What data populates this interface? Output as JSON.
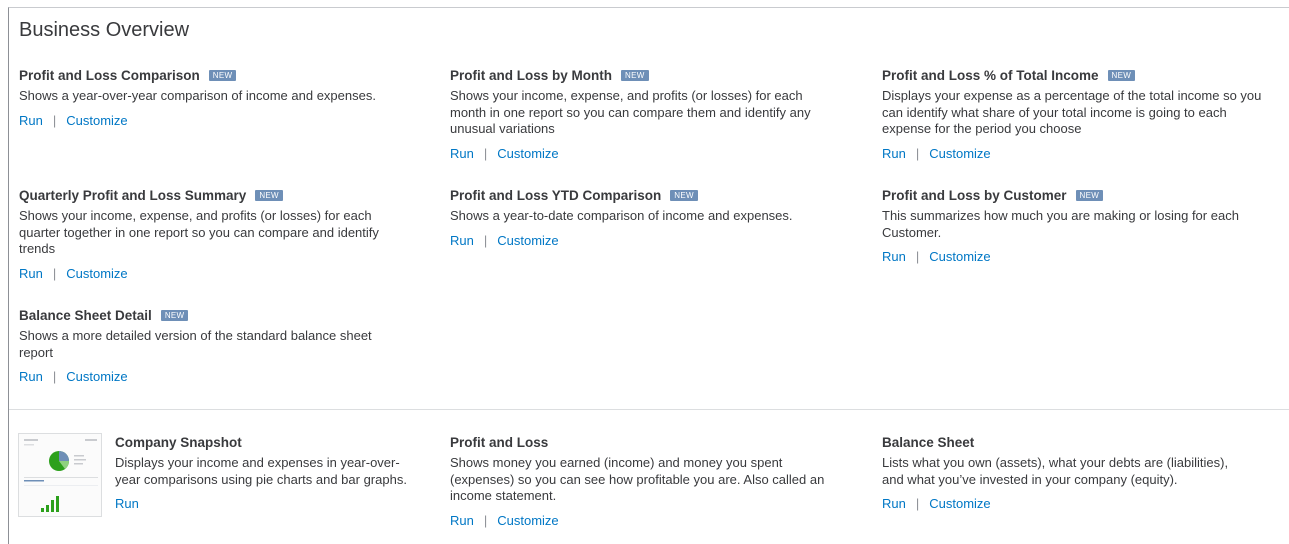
{
  "section": {
    "title": "Business Overview"
  },
  "badge": "NEW",
  "separator": "|",
  "reports": [
    {
      "title": "Profit and Loss Comparison",
      "new": true,
      "description": "Shows a year-over-year comparison of income and expenses.",
      "run": "Run",
      "customize": "Customize"
    },
    {
      "title": "Profit and Loss by Month",
      "new": true,
      "description": "Shows your income, expense, and profits (or losses) for each month in one report so you can compare them and identify any unusual variations",
      "run": "Run",
      "customize": "Customize"
    },
    {
      "title": "Profit and Loss % of Total Income",
      "new": true,
      "description": "Displays your expense as a percentage of the total income so you can identify what share of your total income is going to each expense for the period you choose",
      "run": "Run",
      "customize": "Customize"
    },
    {
      "title": "Quarterly Profit and Loss Summary",
      "new": true,
      "description": "Shows your income, expense, and profits (or losses) for each quarter together in one report so you can compare and identify trends",
      "run": "Run",
      "customize": "Customize"
    },
    {
      "title": "Profit and Loss YTD Comparison",
      "new": true,
      "description": "Shows a year-to-date comparison of income and expenses.",
      "run": "Run",
      "customize": "Customize"
    },
    {
      "title": "Profit and Loss by Customer",
      "new": true,
      "description": "This summarizes how much you are making or losing for each Customer.",
      "run": "Run",
      "customize": "Customize"
    },
    {
      "title": "Balance Sheet Detail",
      "new": true,
      "description": "Shows a more detailed version of the standard balance sheet report",
      "run": "Run",
      "customize": "Customize"
    }
  ],
  "standard": [
    {
      "title": "Company Snapshot",
      "description": "Displays your income and expenses in year-over-year comparisons using pie charts and bar graphs.",
      "run": "Run",
      "thumbnail_icon": "company-snapshot-thumbnail"
    },
    {
      "title": "Profit and Loss",
      "description": "Shows money you earned (income) and money you spent (expenses) so you can see how profitable you are. Also called an income statement.",
      "run": "Run",
      "customize": "Customize"
    },
    {
      "title": "Balance Sheet",
      "description": "Lists what you own (assets), what your debts are (liabilities), and what you’ve invested in your company (equity).",
      "run": "Run",
      "customize": "Customize"
    }
  ],
  "colors": {
    "link": "#0077c5",
    "badge": "#6e8fb7",
    "text": "#393a3d",
    "divider": "#dcdee0",
    "pie": "#2ca01c",
    "pie_slice": "#6e8fb7"
  }
}
